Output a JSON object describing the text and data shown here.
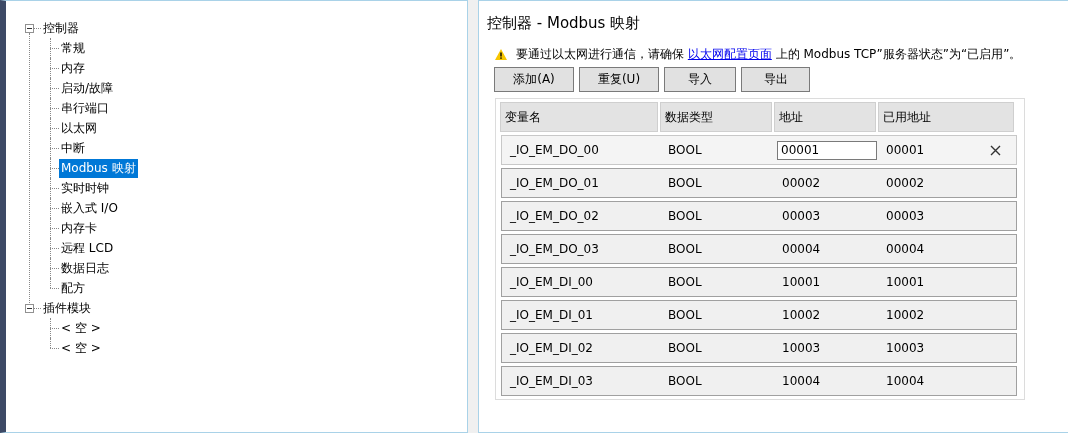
{
  "tree": [
    {
      "label": "控制器",
      "expanded": true,
      "selected": false,
      "children": [
        {
          "label": "常规",
          "selected": false
        },
        {
          "label": "内存",
          "selected": false
        },
        {
          "label": "启动/故障",
          "selected": false
        },
        {
          "label": "串行端口",
          "selected": false
        },
        {
          "label": "以太网",
          "selected": false
        },
        {
          "label": "中断",
          "selected": false
        },
        {
          "label": "Modbus 映射",
          "selected": true
        },
        {
          "label": "实时时钟",
          "selected": false
        },
        {
          "label": "嵌入式 I/O",
          "selected": false
        },
        {
          "label": "内存卡",
          "selected": false
        },
        {
          "label": "远程 LCD",
          "selected": false
        },
        {
          "label": "数据日志",
          "selected": false
        },
        {
          "label": "配方",
          "selected": false
        }
      ]
    },
    {
      "label": "插件模块",
      "expanded": true,
      "selected": false,
      "children": [
        {
          "label": "< 空 >",
          "selected": false
        },
        {
          "label": "< 空 >",
          "selected": false
        }
      ]
    }
  ],
  "panel": {
    "title": "控制器 - Modbus 映射",
    "notice": {
      "before": "要通过以太网进行通信，请确保",
      "link": "以太网配置页面",
      "after": "上的 Modbus TCP”服务器状态”为“已启用”。"
    },
    "buttons": [
      "添加(A)",
      "重复(U)",
      "导入",
      "导出"
    ],
    "table": {
      "columns": [
        "变量名",
        "数据类型",
        "地址",
        "已用地址"
      ],
      "rows": [
        {
          "name": "_IO_EM_DO_00",
          "type": "BOOL",
          "address": "00001",
          "used_address": "00001",
          "selected": true
        },
        {
          "name": "_IO_EM_DO_01",
          "type": "BOOL",
          "address": "00002",
          "used_address": "00002",
          "selected": false
        },
        {
          "name": "_IO_EM_DO_02",
          "type": "BOOL",
          "address": "00003",
          "used_address": "00003",
          "selected": false
        },
        {
          "name": "_IO_EM_DO_03",
          "type": "BOOL",
          "address": "00004",
          "used_address": "00004",
          "selected": false
        },
        {
          "name": "_IO_EM_DI_00",
          "type": "BOOL",
          "address": "10001",
          "used_address": "10001",
          "selected": false
        },
        {
          "name": "_IO_EM_DI_01",
          "type": "BOOL",
          "address": "10002",
          "used_address": "10002",
          "selected": false
        },
        {
          "name": "_IO_EM_DI_02",
          "type": "BOOL",
          "address": "10003",
          "used_address": "10003",
          "selected": false
        },
        {
          "name": "_IO_EM_DI_03",
          "type": "BOOL",
          "address": "10004",
          "used_address": "10004",
          "selected": false
        }
      ]
    }
  }
}
